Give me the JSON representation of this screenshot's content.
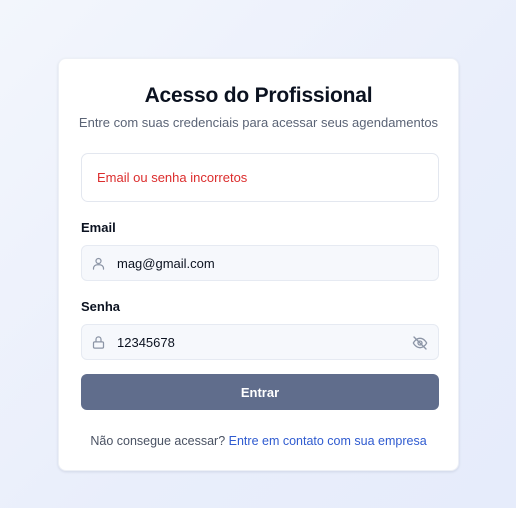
{
  "login": {
    "title": "Acesso do Profissional",
    "subtitle": "Entre com suas credenciais para acessar seus agendamentos",
    "error_message": "Email ou senha incorretos",
    "email_label": "Email",
    "email_value": "mag@gmail.com",
    "password_label": "Senha",
    "password_value": "12345678",
    "submit_label": "Entrar",
    "footer_text": "Não consegue acessar?",
    "footer_link": "Entre em contato com sua empresa"
  },
  "icons": {
    "email_field": "user-icon",
    "password_field": "lock-icon",
    "password_toggle": "eye-off-icon"
  },
  "colors": {
    "error": "#dc2d2d",
    "button": "#606d8c",
    "link": "#2f5bd0"
  }
}
